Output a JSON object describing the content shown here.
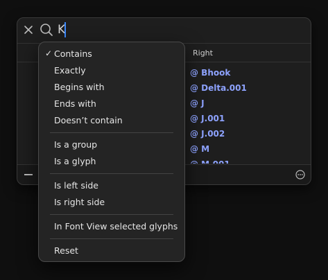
{
  "search": {
    "query": "K"
  },
  "table": {
    "column_right": "Right",
    "rows": [
      "@ Bhook",
      "@ Delta.001",
      "@ J",
      "@ J.001",
      "@ J.002",
      "@ M",
      "@ M.001"
    ]
  },
  "menu": {
    "items": [
      "Contains",
      "Exactly",
      "Begins with",
      "Ends with",
      "Doesn’t contain",
      "Is a group",
      "Is a glyph",
      "Is left side",
      "Is right side",
      "In Font View selected glyphs",
      "Reset"
    ],
    "selected": "Contains",
    "check_glyph": "✓"
  },
  "icons": [
    "close-icon",
    "search-icon",
    "minus-icon",
    "more-icon"
  ],
  "colors": {
    "accent": "#3d8bff",
    "glyph_name": "#8ea3ff"
  }
}
